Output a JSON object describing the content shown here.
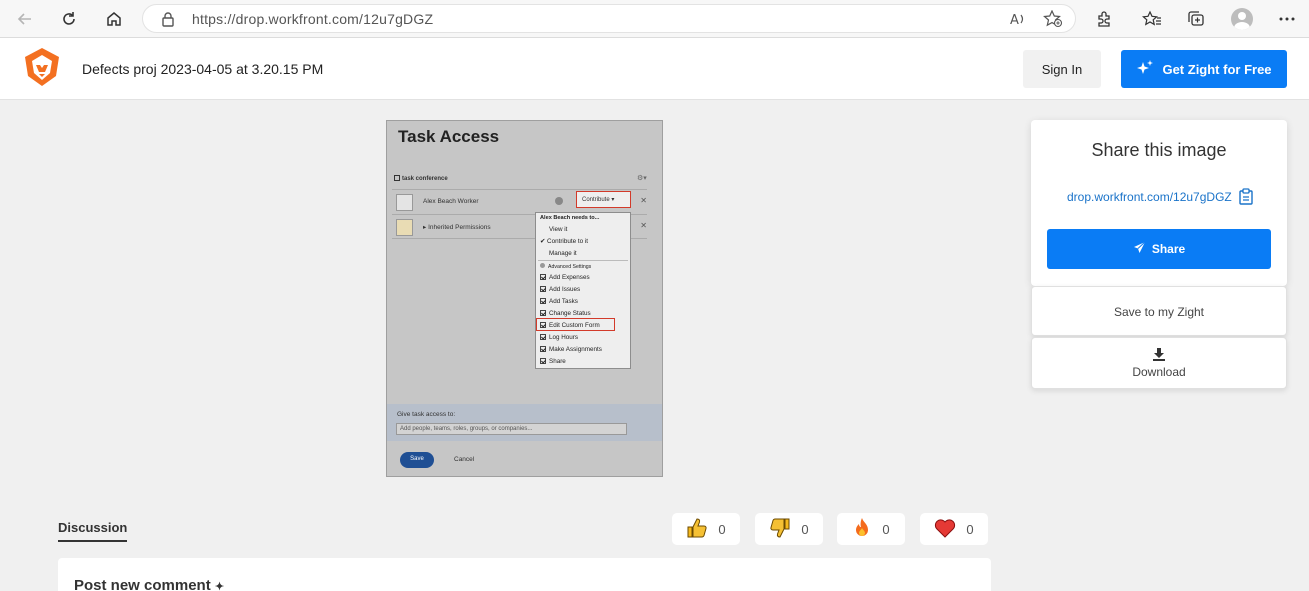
{
  "browser": {
    "url": "https://drop.workfront.com/12u7gDGZ"
  },
  "header": {
    "doc_title": "Defects proj 2023-04-05 at 3.20.15 PM",
    "sign_in_label": "Sign In",
    "get_zight_label": "Get Zight for Free"
  },
  "screenshot": {
    "title": "Task Access",
    "subtitle": "task conference",
    "rows": [
      {
        "name": "Alex Beach Worker"
      },
      {
        "name": "▸ Inherited Permissions"
      }
    ],
    "contribute_label": "Contribute ▾",
    "menu_header": "Alex Beach needs to...",
    "menu_items": [
      "View it",
      "Contribute to it",
      "Manage it"
    ],
    "advanced_label": "Advanced Settings",
    "checkbox_items": [
      "Add Expenses",
      "Add Issues",
      "Add Tasks",
      "Change Status",
      "Edit Custom Form",
      "Log Hours",
      "Make Assignments",
      "Share"
    ],
    "give_access_label": "Give task access to:",
    "input_placeholder": "Add people, teams, roles, groups, or companies...",
    "save_label": "Save",
    "cancel_label": "Cancel"
  },
  "share_panel": {
    "title": "Share this image",
    "link": "drop.workfront.com/12u7gDGZ",
    "share_label": "Share",
    "save_label": "Save to my Zight",
    "download_label": "Download"
  },
  "discussion": {
    "title": "Discussion",
    "reactions": [
      {
        "icon": "thumbs-up-icon",
        "count": "0"
      },
      {
        "icon": "thumbs-down-icon",
        "count": "0"
      },
      {
        "icon": "fire-icon",
        "count": "0"
      },
      {
        "icon": "heart-icon",
        "count": "0"
      }
    ],
    "comment_title": "Post new comment"
  },
  "colors": {
    "accent": "#0a7cf5",
    "highlight_border": "#d23a2a",
    "logo_orange": "#f37021"
  }
}
